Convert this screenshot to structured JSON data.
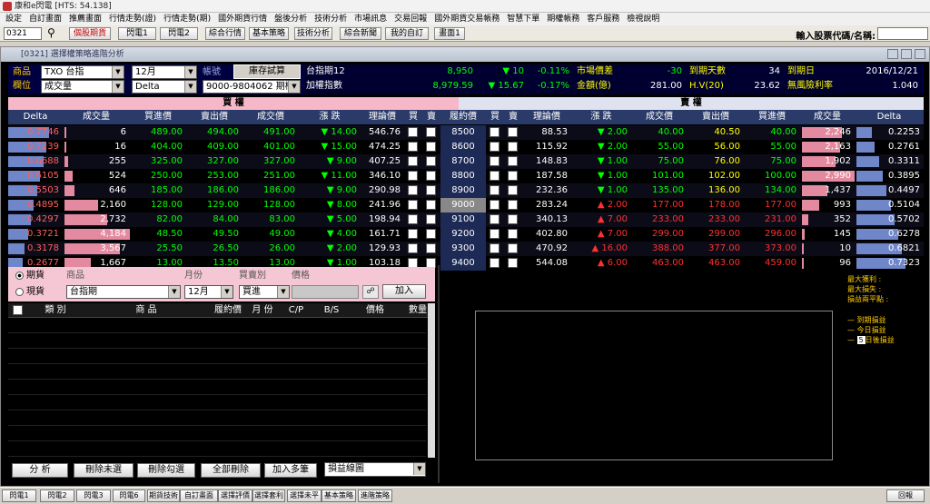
{
  "title": "康和e閃電 [HTS: 54.138]",
  "menu": [
    "設定",
    "自訂畫面",
    "推薦畫面",
    "行情走勢(證)",
    "行情走勢(期)",
    "國外期貨行情",
    "盤後分析",
    "技術分析",
    "市場訊息",
    "交易回報",
    "國外期貨交易帳務",
    "智慧下單",
    "期權帳務",
    "客戶服務",
    "檢視說明"
  ],
  "toolbar": {
    "code": "0321",
    "buttons": [
      "個股期貨",
      "閃電1",
      "閃電2",
      "綜合行情",
      "基本策略",
      "技術分析",
      "綜合新聞",
      "我的自訂",
      "畫面1"
    ],
    "stock_label": "輸入股票代碼/名稱:"
  },
  "window_title": "[0321] 選擇權策略進階分析",
  "info": {
    "product_label": "商品",
    "product": "TXO 台指",
    "month": "12月",
    "account_label": "帳號",
    "calc_button": "庫存試算",
    "field_label": "欄位",
    "field": "成交量",
    "greek": "Delta",
    "account": "9000-9804062 期權",
    "index_name": "台指期12",
    "index_price": "8,950",
    "index_chg": "▼ 10",
    "index_pct": "-0.11%",
    "weighted_name": "加權指數",
    "weighted_price": "8,979.59",
    "weighted_chg": "▼ 15.67",
    "weighted_pct": "-0.17%",
    "spread_label": "市場價差",
    "spread": "-30",
    "amount_label": "金額(億)",
    "amount": "281.00",
    "days_label": "到期天數",
    "days": "34",
    "hv_label": "H.V(20)",
    "hv": "23.62",
    "expiry_label": "到期日",
    "expiry": "2016/12/21",
    "rate_label": "無風險利率",
    "rate": "1.040"
  },
  "call_label": "買  權",
  "put_label": "賣  權",
  "headers": [
    "Delta",
    "成交量",
    "買進價",
    "賣出價",
    "成交價",
    "漲 跌",
    "理論價",
    "買",
    "賣",
    "履約價",
    "買",
    "賣",
    "理論價",
    "漲 跌",
    "成交價",
    "賣出價",
    "買進價",
    "成交量",
    "Delta"
  ],
  "rows": [
    [
      "0.7746",
      "6",
      "489.00",
      "494.00",
      "491.00",
      "▼ 14.00",
      "546.76",
      "8500",
      "88.53",
      "▼ 2.00",
      "40.00",
      "40.50",
      "40.00",
      "2,246",
      "0.2253"
    ],
    [
      "0.7239",
      "16",
      "404.00",
      "409.00",
      "401.00",
      "▼ 15.00",
      "474.25",
      "8600",
      "115.92",
      "▼ 2.00",
      "55.00",
      "56.00",
      "55.00",
      "2,163",
      "0.2761"
    ],
    [
      "0.6688",
      "255",
      "325.00",
      "327.00",
      "327.00",
      "▼ 9.00",
      "407.25",
      "8700",
      "148.83",
      "▼ 1.00",
      "75.00",
      "76.00",
      "75.00",
      "1,902",
      "0.3311"
    ],
    [
      "0.6105",
      "524",
      "250.00",
      "253.00",
      "251.00",
      "▼ 11.00",
      "346.10",
      "8800",
      "187.58",
      "▼ 1.00",
      "101.00",
      "102.00",
      "100.00",
      "2,990",
      "0.3895"
    ],
    [
      "0.5503",
      "646",
      "185.00",
      "186.00",
      "186.00",
      "▼ 9.00",
      "290.98",
      "8900",
      "232.36",
      "▼ 1.00",
      "135.00",
      "136.00",
      "134.00",
      "1,437",
      "0.4497"
    ],
    [
      "0.4895",
      "2,160",
      "128.00",
      "129.00",
      "128.00",
      "▼ 8.00",
      "241.96",
      "9000",
      "283.24",
      "▲ 2.00",
      "177.00",
      "178.00",
      "177.00",
      "993",
      "0.5104"
    ],
    [
      "0.4297",
      "2,732",
      "82.00",
      "84.00",
      "83.00",
      "▼ 5.00",
      "198.94",
      "9100",
      "340.13",
      "▲ 7.00",
      "233.00",
      "233.00",
      "231.00",
      "352",
      "0.5702"
    ],
    [
      "0.3721",
      "4,184",
      "48.50",
      "49.50",
      "49.00",
      "▼ 4.00",
      "161.71",
      "9200",
      "402.80",
      "▲ 7.00",
      "299.00",
      "299.00",
      "296.00",
      "145",
      "0.6278"
    ],
    [
      "0.3178",
      "3,567",
      "25.50",
      "26.50",
      "26.00",
      "▼ 2.00",
      "129.93",
      "9300",
      "470.92",
      "▲ 16.00",
      "388.00",
      "377.00",
      "373.00",
      "10",
      "0.6821"
    ],
    [
      "0.2677",
      "1,667",
      "13.00",
      "13.50",
      "13.00",
      "▼ 1.00",
      "103.18",
      "9400",
      "544.08",
      "▲ 6.00",
      "463.00",
      "463.00",
      "459.00",
      "96",
      "0.7323"
    ]
  ],
  "order": {
    "radio_futures": "期貨",
    "radio_spot": "現貨",
    "product_label": "商品",
    "product": "台指期",
    "month_label": "月份",
    "month": "12月",
    "side_label": "買賣別",
    "side": "買進",
    "price_label": "價格",
    "add_button": "加入"
  },
  "pos_headers": [
    "類  別",
    "商  品",
    "履約價",
    "月 份",
    "C/P",
    "B/S",
    "價格",
    "數量"
  ],
  "bottom_buttons": [
    "分  析",
    "刪除未選",
    "刪除勾選",
    "全部刪除",
    "加入多筆"
  ],
  "chart_select": "損益線圖",
  "legend": {
    "max_profit": "最大獲利 :",
    "max_loss": "最大損失 :",
    "breakeven": "損益兩平點 :",
    "l1": "到期損益",
    "l2": "今日損益",
    "days_value": "5",
    "l3": "日後損益"
  },
  "status_buttons": [
    "閃電1",
    "閃電2",
    "閃電3",
    "閃電6",
    "期貨技術",
    "自訂畫面",
    "選擇評價",
    "選擇套利",
    "選擇未平",
    "基本策略",
    "進階策略"
  ],
  "status_right": "回報",
  "colors": {
    "call_header": "#f6b8c9",
    "put_header": "#dfe3f0"
  }
}
